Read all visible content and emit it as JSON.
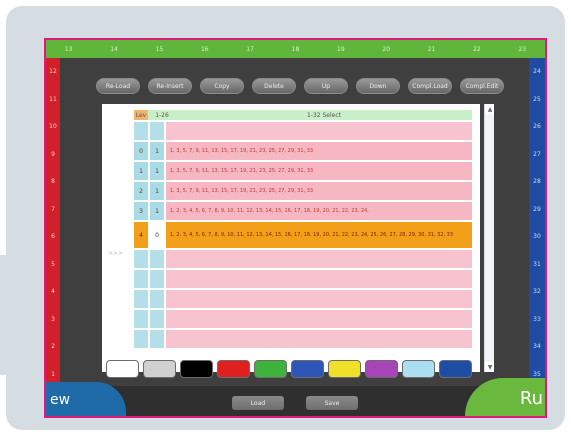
{
  "toolbar": {
    "buttons": [
      "Re-Load",
      "Re-Insert",
      "Copy",
      "Delete",
      "Up",
      "Down",
      "Compl.Load",
      "Compl.Edit"
    ]
  },
  "rulers": {
    "top": [
      "13",
      "14",
      "15",
      "16",
      "17",
      "18",
      "19",
      "20",
      "21",
      "22",
      "23"
    ],
    "left": [
      "12",
      "11",
      "10",
      "9",
      "8",
      "7",
      "6",
      "5",
      "4",
      "3",
      "2",
      "1"
    ],
    "right": [
      "24",
      "25",
      "26",
      "27",
      "28",
      "29",
      "30",
      "31",
      "32",
      "33",
      "34",
      "35"
    ]
  },
  "table": {
    "header": {
      "c1": "Lev",
      "c2": "1-26",
      "c3": "1-32 Select"
    },
    "rows": [
      {
        "idx": "0",
        "val": "1",
        "seq": "1, 3, 5, 7, 9, 11, 13, 15, 17, 19, 21, 23, 25, 27, 29, 31, 33"
      },
      {
        "idx": "1",
        "val": "1",
        "seq": "1, 3, 5, 7, 9, 11, 13, 15, 17, 19, 21, 23, 25, 27, 29, 31, 33"
      },
      {
        "idx": "2",
        "val": "1",
        "seq": "1, 3, 5, 7, 9, 11, 13, 15, 17, 19, 21, 23, 25, 27, 29, 31, 33"
      },
      {
        "idx": "3",
        "val": "1",
        "seq": "1, 2, 3, 4, 5, 6, 7, 8, 9, 10, 11, 12, 13, 14, 15, 16, 17, 18, 19, 20, 21, 22, 23, 24,"
      },
      {
        "idx": "4",
        "val": "0",
        "seq": "1, 2, 3, 4, 5, 6, 7, 8, 9, 10, 11, 12, 13, 14, 15, 16, 17, 18, 19, 20, 21, 22, 23, 24, 25, 26, 27, 28, 29, 30, 31, 32, 33"
      }
    ],
    "pointer": ">>>"
  },
  "scroll": {
    "up": "▲",
    "down": "▼"
  },
  "palette": [
    "#ffffff",
    "#d0d0d0",
    "#000000",
    "#e02020",
    "#3db33d",
    "#2e55b8",
    "#f0e02a",
    "#a645b5",
    "#a9dff0",
    "#1e4ea3"
  ],
  "footer": {
    "left_label": "ew",
    "right_label": "Ru",
    "load": "Load",
    "save": "Save"
  }
}
